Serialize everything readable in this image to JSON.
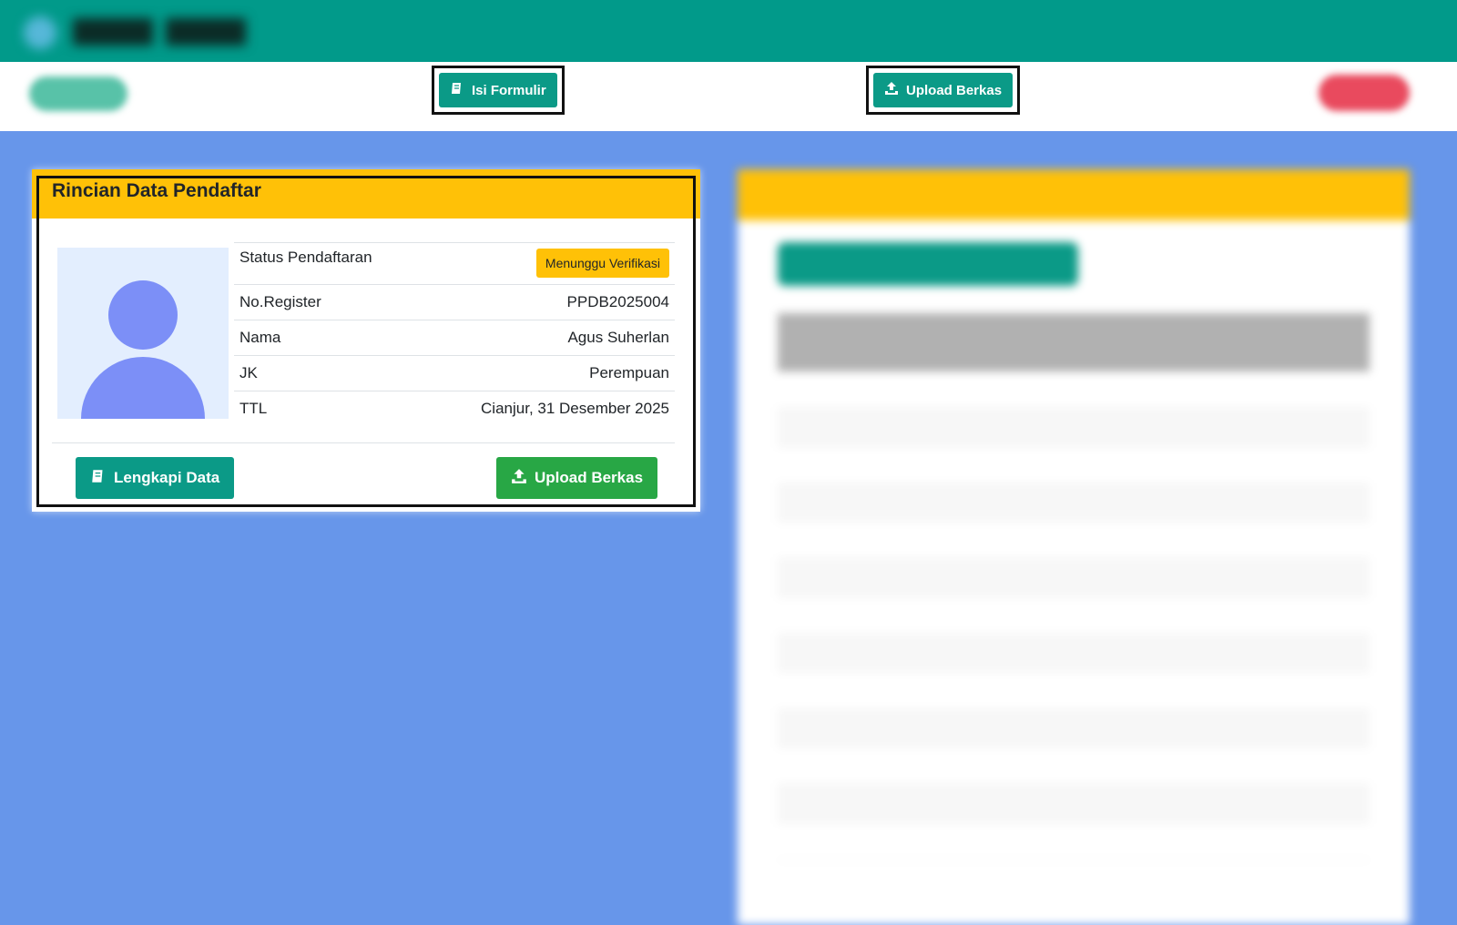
{
  "header": {
    "nav_isi_formulir": "Isi Formulir",
    "nav_upload_berkas": "Upload Berkas"
  },
  "left_card": {
    "title": "Rincian Data Pendaftar",
    "rows": [
      {
        "label": "Status Pendaftaran",
        "badge": "Menunggu Verifikasi"
      },
      {
        "label": "No.Register",
        "value": "PPDB2025004"
      },
      {
        "label": "Nama",
        "value": "Agus Suherlan"
      },
      {
        "label": "JK",
        "value": "Perempuan"
      },
      {
        "label": "TTL",
        "value": "Cianjur, 31 Desember 2025"
      }
    ],
    "btn_lengkapi": "Lengkapi Data",
    "btn_upload": "Upload Berkas"
  },
  "colors": {
    "topbar": "#019a8a",
    "teal_button": "#0b9a87",
    "green_button": "#28a745",
    "accent_yellow": "#ffc107",
    "page_bg": "#6796ea"
  },
  "icons": {
    "nav_isi_formulir": "book-icon",
    "nav_upload_berkas": "upload-icon",
    "btn_lengkapi": "book-icon",
    "btn_upload": "upload-icon"
  }
}
